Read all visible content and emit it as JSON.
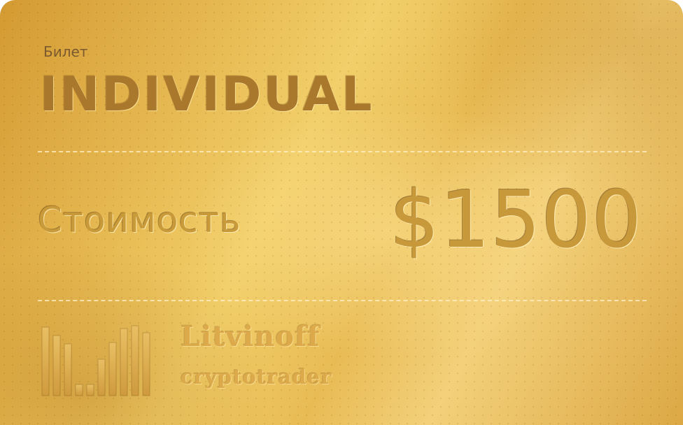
{
  "ticket": {
    "label": "Билет",
    "type": "INDIVIDUAL",
    "price_label": "Стоимость",
    "price_value": "$1500"
  },
  "brand": {
    "name": "Litvinoff",
    "subtitle": "cryptotrader",
    "logo_icon": "bar-chart-logo-icon"
  },
  "colors": {
    "gold_light": "#f2cf6a",
    "gold_mid": "#e4b54e",
    "gold_dark": "#a9782c"
  }
}
